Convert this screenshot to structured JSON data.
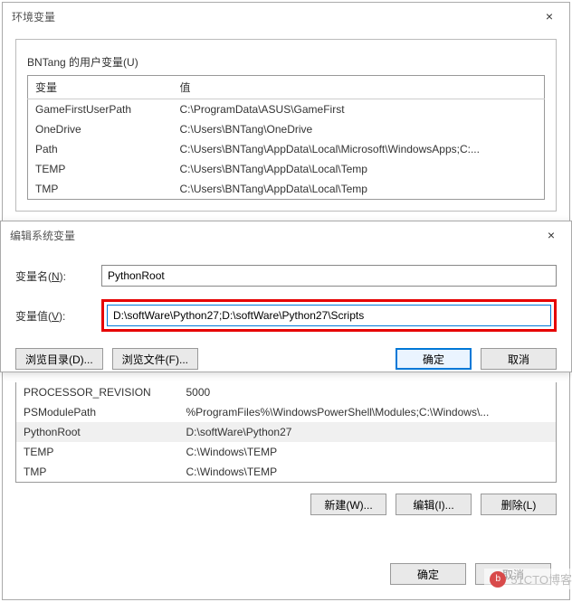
{
  "env_dialog": {
    "title": "环境变量",
    "close": "×",
    "user_vars_label": "BNTang 的用户变量(U)",
    "columns": {
      "var": "变量",
      "val": "值"
    },
    "user_rows": [
      {
        "var": "GameFirstUserPath",
        "val": "C:\\ProgramData\\ASUS\\GameFirst"
      },
      {
        "var": "OneDrive",
        "val": "C:\\Users\\BNTang\\OneDrive"
      },
      {
        "var": "Path",
        "val": "C:\\Users\\BNTang\\AppData\\Local\\Microsoft\\WindowsApps;C:..."
      },
      {
        "var": "TEMP",
        "val": "C:\\Users\\BNTang\\AppData\\Local\\Temp"
      },
      {
        "var": "TMP",
        "val": "C:\\Users\\BNTang\\AppData\\Local\\Temp"
      }
    ],
    "sys_rows": [
      {
        "var": "PROCESSOR_REVISION",
        "val": "5000"
      },
      {
        "var": "PSModulePath",
        "val": "%ProgramFiles%\\WindowsPowerShell\\Modules;C:\\Windows\\..."
      },
      {
        "var": "PythonRoot",
        "val": "D:\\softWare\\Python27"
      },
      {
        "var": "TEMP",
        "val": "C:\\Windows\\TEMP"
      },
      {
        "var": "TMP",
        "val": "C:\\Windows\\TEMP"
      }
    ],
    "btn_new": "新建(W)...",
    "btn_edit": "编辑(I)...",
    "btn_delete": "删除(L)",
    "btn_ok": "确定",
    "btn_cancel": "取消"
  },
  "edit_dialog": {
    "title": "编辑系统变量",
    "close": "×",
    "name_label": "变量名(",
    "name_key": "N",
    "name_label2": "):",
    "name_value": "PythonRoot",
    "val_label": "变量值(",
    "val_key": "V",
    "val_label2": "):",
    "val_value": "D:\\softWare\\Python27;D:\\softWare\\Python27\\Scripts",
    "btn_browse_dir": "浏览目录(D)...",
    "btn_browse_file": "浏览文件(F)...",
    "btn_ok": "确定",
    "btn_cancel": "取消"
  },
  "watermark": {
    "text": "51CTO博客"
  }
}
